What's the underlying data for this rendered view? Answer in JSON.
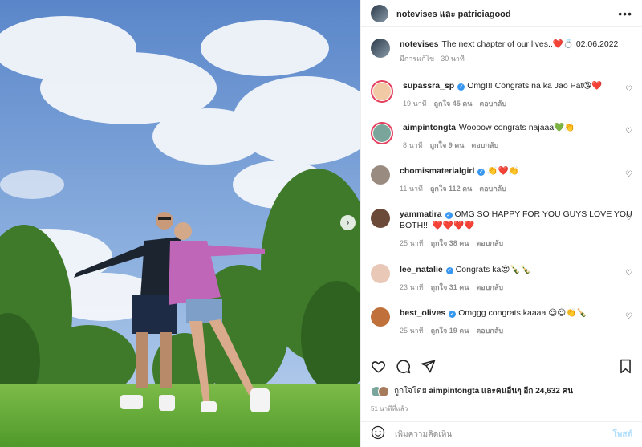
{
  "header": {
    "names": "notevises และ patriciagood"
  },
  "caption": {
    "username": "notevises",
    "text": "The next chapter of our lives..❤️💍 02.06.2022",
    "meta": "มีการแก้ไข · 30 นาที"
  },
  "comments": [
    {
      "username": "supassra_sp",
      "verified": true,
      "text": "Omg!!! Congrats na ka Jao Pat😘❤️",
      "time": "19 นาที",
      "likes": "ถูกใจ 45 คน",
      "reply": "ตอบกลับ",
      "avatar_color": "#f1c9a5",
      "ring": true
    },
    {
      "username": "aimpintongta",
      "verified": false,
      "text": "Woooow congrats najaaa💚👏",
      "time": "8 นาที",
      "likes": "ถูกใจ 9 คน",
      "reply": "ตอบกลับ",
      "avatar_color": "#7aa59a",
      "ring": true
    },
    {
      "username": "chomismaterialgirl",
      "verified": true,
      "text": "👏❤️👏",
      "time": "11 นาที",
      "likes": "ถูกใจ 112 คน",
      "reply": "ตอบกลับ",
      "avatar_color": "#9a8b80",
      "ring": false
    },
    {
      "username": "yammatira",
      "verified": true,
      "text": "OMG SO HAPPY FOR YOU GUYS LOVE YOU BOTH!!! ❤️❤️❤️❤️",
      "time": "25 นาที",
      "likes": "ถูกใจ 38 คน",
      "reply": "ตอบกลับ",
      "avatar_color": "#6b4a3a",
      "ring": false
    },
    {
      "username": "lee_natalie",
      "verified": true,
      "text": "Congrats ka😍🍾🍾",
      "time": "23 นาที",
      "likes": "ถูกใจ 31 คน",
      "reply": "ตอบกลับ",
      "avatar_color": "#e9c8b8",
      "ring": false
    },
    {
      "username": "best_olives",
      "verified": true,
      "text": "Omggg congrats kaaaa 😍😍👏🍾",
      "time": "25 นาที",
      "likes": "ถูกใจ 19 คน",
      "reply": "ตอบกลับ",
      "avatar_color": "#c0703a",
      "ring": false
    }
  ],
  "likes_line": {
    "prefix": "ถูกใจโดย",
    "user": "aimpintongta",
    "middle": "และคนอื่นๆ อีก",
    "count": "24,632 คน"
  },
  "time_ago": "51 นาทีที่แล้ว",
  "composer": {
    "placeholder": "เพิ่มความคิดเห็น",
    "post_label": "โพสต์"
  },
  "icons": {
    "more": "more-icon",
    "like": "heart-icon",
    "comment": "comment-icon",
    "share": "share-icon",
    "save": "bookmark-icon",
    "emoji": "emoji-icon",
    "next": "chevron-right-icon"
  }
}
